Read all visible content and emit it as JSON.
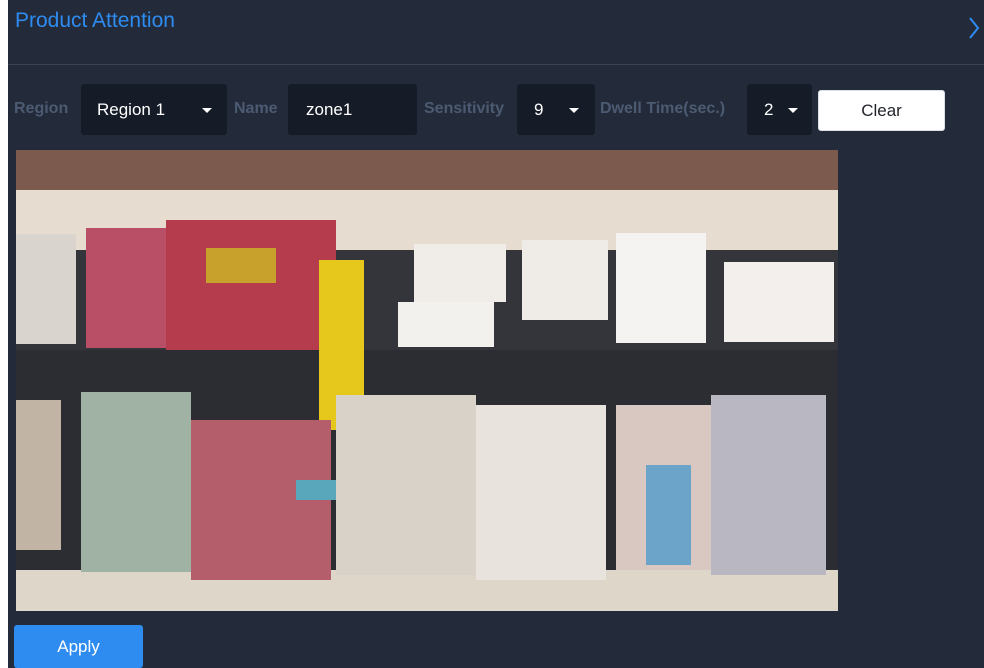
{
  "header": {
    "title": "Product Attention"
  },
  "controls": {
    "region_label": "Region",
    "region_value": "Region 1",
    "name_label": "Name",
    "name_value": "zone1",
    "sensitivity_label": "Sensitivity",
    "sensitivity_value": "9",
    "dwell_label": "Dwell Time(sec.)",
    "dwell_value": "2",
    "clear_label": "Clear"
  },
  "footer": {
    "apply_label": "Apply"
  },
  "colors": {
    "panel_bg": "#232b3a",
    "accent": "#2e8cf0",
    "field_bg": "#151b27",
    "label": "#4c5a72"
  }
}
